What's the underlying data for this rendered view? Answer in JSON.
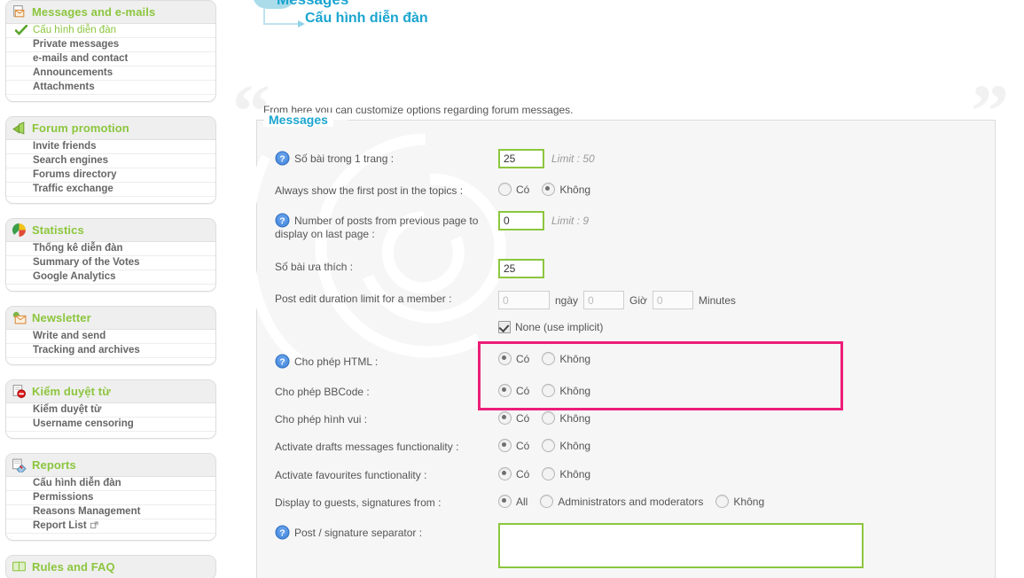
{
  "sidebar": {
    "blocks": [
      {
        "title": "Messages and e-mails",
        "icon": "mail-message-icon",
        "items": [
          {
            "label": "Cấu hình diễn đàn",
            "active": true
          },
          {
            "label": "Private messages",
            "active": false
          },
          {
            "label": "e-mails and contact",
            "active": false
          },
          {
            "label": "Announcements",
            "active": false
          },
          {
            "label": "Attachments",
            "active": false
          }
        ]
      },
      {
        "title": "Forum promotion",
        "icon": "megaphone-icon",
        "items": [
          {
            "label": "Invite friends",
            "active": false
          },
          {
            "label": "Search engines",
            "active": false
          },
          {
            "label": "Forums directory",
            "active": false
          },
          {
            "label": "Traffic exchange",
            "active": false
          }
        ]
      },
      {
        "title": "Statistics",
        "icon": "pie-chart-icon",
        "items": [
          {
            "label": "Thống kê diễn đàn",
            "active": false
          },
          {
            "label": "Summary of the Votes",
            "active": false
          },
          {
            "label": "Google Analytics",
            "active": false
          }
        ]
      },
      {
        "title": "Newsletter",
        "icon": "envelope-icon",
        "items": [
          {
            "label": "Write and send",
            "active": false
          },
          {
            "label": "Tracking and archives",
            "active": false
          }
        ]
      },
      {
        "title": "Kiểm duyệt từ",
        "icon": "block-icon",
        "items": [
          {
            "label": "Kiểm duyệt từ",
            "active": false
          },
          {
            "label": "Username censoring",
            "active": false
          }
        ]
      },
      {
        "title": "Reports",
        "icon": "report-icon",
        "items": [
          {
            "label": "Cấu hình diễn đàn",
            "active": false
          },
          {
            "label": "Permissions",
            "active": false
          },
          {
            "label": "Reasons Management",
            "active": false
          },
          {
            "label": "Report List",
            "active": false,
            "external": true
          }
        ]
      },
      {
        "title": "Rules and FAQ",
        "icon": "book-icon",
        "items": []
      }
    ]
  },
  "breadcrumb": {
    "cut_title": "Messages",
    "current": "Cấu hình diễn đàn"
  },
  "description": "From here you can customize options regarding forum messages.",
  "panel": {
    "legend": "Messages",
    "rows": [
      {
        "name": "posts-per-page",
        "label": "Số bài trong 1 trang :",
        "help": true,
        "type": "input",
        "value": "25",
        "limit": "Limit : 50"
      },
      {
        "name": "always-show-first-post",
        "label": "Always show the first post in the topics :",
        "help": false,
        "type": "radio",
        "options": [
          {
            "label": "Có",
            "selected": false
          },
          {
            "label": "Không",
            "selected": true
          }
        ]
      },
      {
        "name": "posts-from-previous-page",
        "label": "Number of posts from previous page to display on last page :",
        "help": true,
        "type": "input",
        "value": "0",
        "limit": "Limit : 9"
      },
      {
        "name": "favourite-posts",
        "label": "Số bài ưa thích :",
        "help": false,
        "type": "input",
        "value": "25",
        "limit": ""
      },
      {
        "name": "post-edit-duration",
        "label": "Post edit duration limit for a member :",
        "help": false,
        "type": "duration",
        "days": {
          "value": "0",
          "unit": "ngày"
        },
        "hours": {
          "value": "0",
          "unit": "Giờ"
        },
        "minutes": {
          "value": "0",
          "unit": "Minutes"
        },
        "none_checkbox": {
          "label": "None (use implicit)",
          "checked": true
        }
      },
      {
        "name": "allow-html",
        "label": "Cho phép HTML :",
        "help": true,
        "type": "radio",
        "highlighted": true,
        "options": [
          {
            "label": "Có",
            "selected": true
          },
          {
            "label": "Không",
            "selected": false
          }
        ]
      },
      {
        "name": "allow-bbcode",
        "label": "Cho phép BBCode :",
        "help": false,
        "type": "radio",
        "highlighted": true,
        "options": [
          {
            "label": "Có",
            "selected": true
          },
          {
            "label": "Không",
            "selected": false
          }
        ]
      },
      {
        "name": "allow-smilies",
        "label": "Cho phép hình vui :",
        "help": false,
        "type": "radio",
        "options": [
          {
            "label": "Có",
            "selected": true
          },
          {
            "label": "Không",
            "selected": false
          }
        ]
      },
      {
        "name": "activate-drafts",
        "label": "Activate drafts messages functionality :",
        "help": false,
        "type": "radio",
        "options": [
          {
            "label": "Có",
            "selected": true
          },
          {
            "label": "Không",
            "selected": false
          }
        ]
      },
      {
        "name": "activate-favourites",
        "label": "Activate favourites functionality :",
        "help": false,
        "type": "radio",
        "options": [
          {
            "label": "Có",
            "selected": true
          },
          {
            "label": "Không",
            "selected": false
          }
        ]
      },
      {
        "name": "guest-signatures",
        "label": "Display to guests, signatures from :",
        "help": false,
        "type": "radio",
        "options": [
          {
            "label": "All",
            "selected": true
          },
          {
            "label": "Administrators and moderators",
            "selected": false
          },
          {
            "label": "Không",
            "selected": false
          }
        ]
      },
      {
        "name": "signature-separator",
        "label": "Post / signature separator :",
        "help": true,
        "type": "textarea",
        "value": ""
      }
    ]
  },
  "colors": {
    "accent_green": "#8cc63e",
    "accent_blue": "#1ba5d0",
    "highlight_pink": "#ec1e79",
    "text": "#555555",
    "panel_bg": "#f6f6f6"
  }
}
